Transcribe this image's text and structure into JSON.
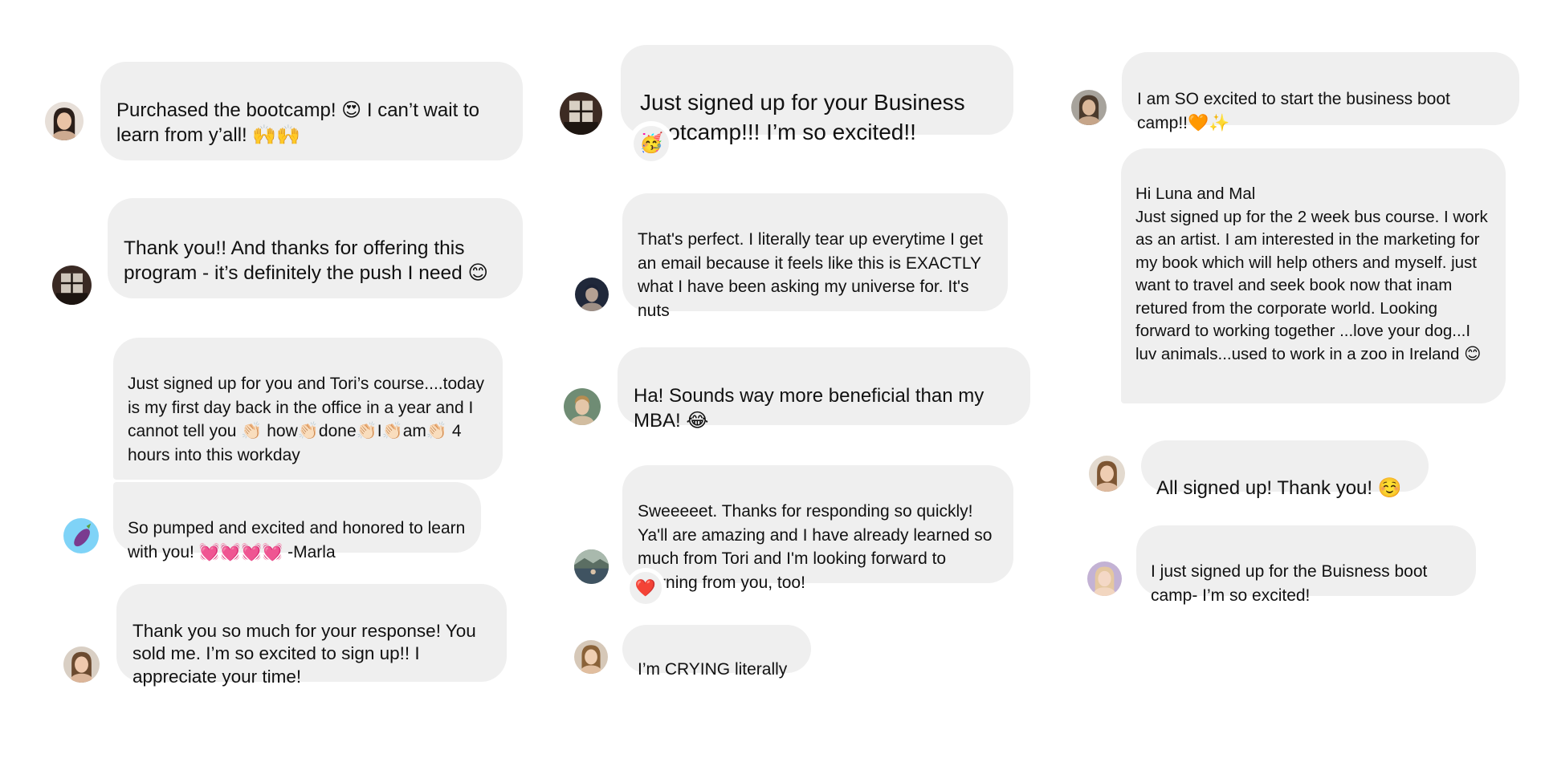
{
  "columns": [
    {
      "name": "left",
      "messages": [
        {
          "id": "m1",
          "text": "Purchased the bootcamp! 😍 I can’t wait to learn from y’all! 🙌🙌"
        },
        {
          "id": "m2",
          "text": "Thank you!! And thanks for offering this program - it’s definitely the push I need 😊"
        },
        {
          "id": "m3",
          "text": "Just signed up for you and Tori’s course....today is my first day back in the office in a year and I cannot tell you 👏🏻 how👏🏻done👏🏻I👏🏻am👏🏻 4 hours into this workday"
        },
        {
          "id": "m4",
          "text": "So pumped and excited and honored to learn with you! 💓💓💓💓 -Marla"
        },
        {
          "id": "m5",
          "text": "Thank you so much for your response! You sold me. I’m so excited to sign up!! I appreciate your time!"
        }
      ]
    },
    {
      "name": "middle",
      "messages": [
        {
          "id": "m6",
          "text": "Just signed up for your Business Bootcamp!!! I’m so excited!!",
          "reaction": "🥳"
        },
        {
          "id": "m7",
          "text": "That's perfect. I literally tear up everytime I get an email because it feels like this is EXACTLY what I have been asking my universe for. It's nuts"
        },
        {
          "id": "m8",
          "text": "Ha! Sounds way more beneficial than my MBA! 😂"
        },
        {
          "id": "m9",
          "text": "Sweeeeet. Thanks for responding so quickly! Ya'll are amazing and I have already learned so much from Tori and I'm looking forward to learning from you, too!",
          "reaction": "❤️"
        },
        {
          "id": "m10",
          "text": "I’m CRYING literally"
        }
      ]
    },
    {
      "name": "right",
      "messages": [
        {
          "id": "m11",
          "text": "I am SO excited to start the business boot camp!!🧡✨"
        },
        {
          "id": "m12",
          "text": "Hi Luna and Mal\nJust signed up for the 2 week bus course. I work as an artist. I am interested in the marketing for my book which will help others and myself. just want to travel and seek book now that inam retured from the corporate world.  Looking forward to working together ...love your dog...I luv animals...used to work in a zoo in Ireland 😊"
        },
        {
          "id": "m13",
          "text": "All signed up! Thank you! ☺️"
        },
        {
          "id": "m14",
          "text": "I just signed up for the Buisness boot camp- I’m so excited!"
        }
      ]
    }
  ],
  "avatars": [
    {
      "id": "a1",
      "icon": "woman-avatar-icon",
      "colors": {
        "bg": "#e7dfd8",
        "hair": "#2b1f1a",
        "skin": "#e9c3a6"
      }
    },
    {
      "id": "a2",
      "icon": "window-photo-avatar-icon",
      "colors": {
        "bg": "#3a2a24",
        "light": "#cfc6bb",
        "frame": "#1c1410"
      }
    },
    {
      "id": "a3",
      "icon": "eggplant-avatar-icon",
      "colors": {
        "bg": "#7fd3f7",
        "eggplant": "#7a3b8f",
        "leaf": "#5aa03c"
      }
    },
    {
      "id": "a4",
      "icon": "woman-avatar-icon",
      "colors": {
        "bg": "#d9cfc4",
        "hair": "#6b4a2f",
        "skin": "#f0c9ad"
      }
    },
    {
      "id": "a5",
      "icon": "window-photo-avatar-icon",
      "colors": {
        "bg": "#3d2b23",
        "light": "#d8cfc3",
        "frame": "#1e1611"
      }
    },
    {
      "id": "a6",
      "icon": "dark-portrait-avatar-icon",
      "colors": {
        "bg": "#20283a",
        "hair": "#1c2336",
        "skin": "#b5a193"
      }
    },
    {
      "id": "a7",
      "icon": "man-avatar-icon",
      "colors": {
        "bg": "#6f8c74",
        "hair": "#b58d52",
        "skin": "#e4c6a8"
      }
    },
    {
      "id": "a8",
      "icon": "landscape-avatar-icon",
      "colors": {
        "bg": "#5b6e63",
        "sky": "#a9b9ad",
        "water": "#3f5361"
      }
    },
    {
      "id": "a9",
      "icon": "woman-avatar-icon",
      "colors": {
        "bg": "#d6c8b8",
        "hair": "#8a6238",
        "skin": "#f0cfb2"
      }
    },
    {
      "id": "a10",
      "icon": "woman-avatar-icon",
      "colors": {
        "bg": "#a7a39c",
        "hair": "#4b3a2c",
        "skin": "#dcb89a"
      }
    },
    {
      "id": "a11",
      "icon": "woman-avatar-icon",
      "colors": {
        "bg": "#e3dacf",
        "hair": "#7d5532",
        "skin": "#efcdb2"
      }
    },
    {
      "id": "a12",
      "icon": "woman-avatar-icon",
      "colors": {
        "bg": "#c3b2d4",
        "hair": "#e4c7a0",
        "skin": "#f4d8c6"
      }
    }
  ]
}
